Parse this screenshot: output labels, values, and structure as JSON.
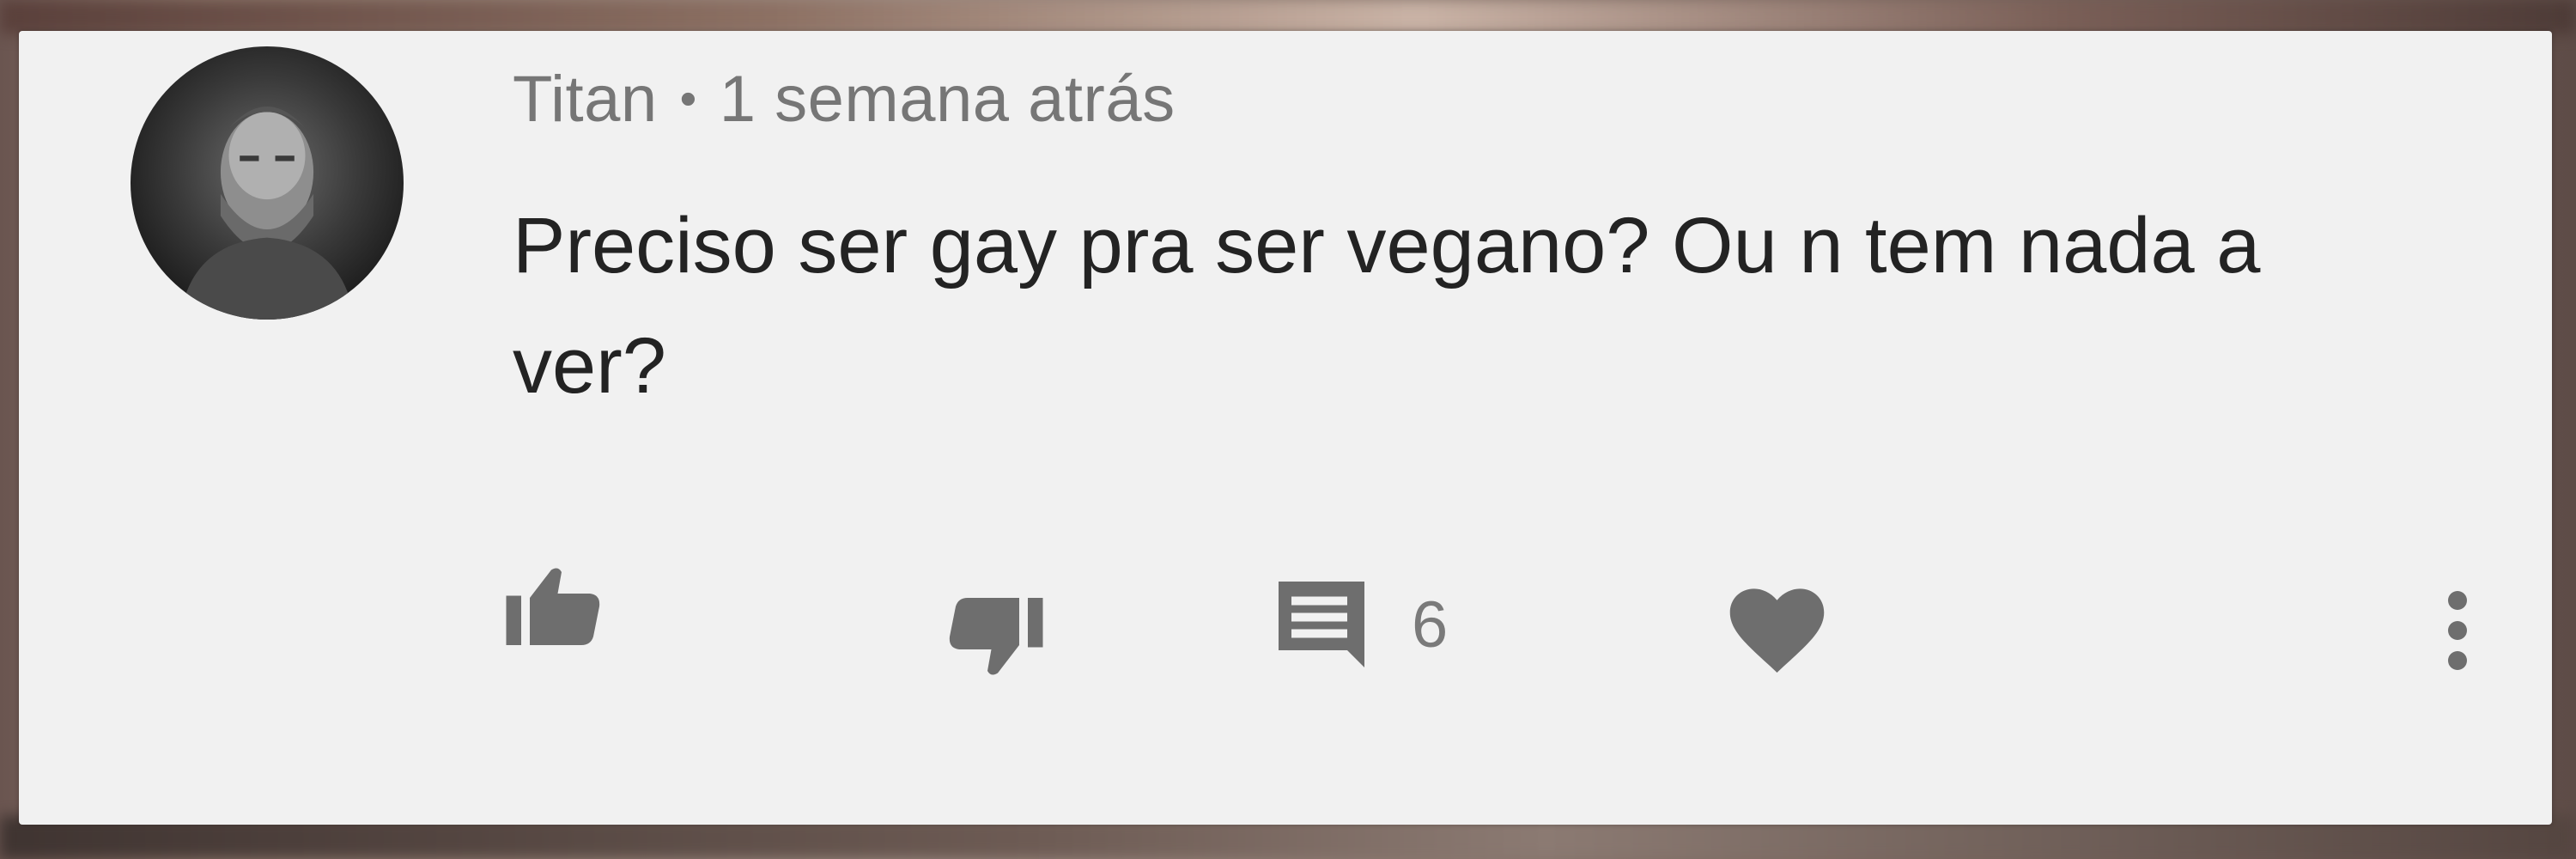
{
  "comment": {
    "author": "Titan",
    "separator": "•",
    "time": "1 semana atrás",
    "text": "Preciso ser gay pra ser vegano? Ou n tem nada a ver?",
    "reply_count": "6"
  },
  "icons": {
    "like": "thumbs-up-icon",
    "dislike": "thumbs-down-icon",
    "reply": "comment-icon",
    "heart": "heart-icon",
    "more": "more-vertical-icon"
  },
  "colors": {
    "card_background": "#f1f1f1",
    "text_primary": "#232323",
    "text_secondary": "#767676",
    "icon_gray": "#6e6e6e"
  }
}
